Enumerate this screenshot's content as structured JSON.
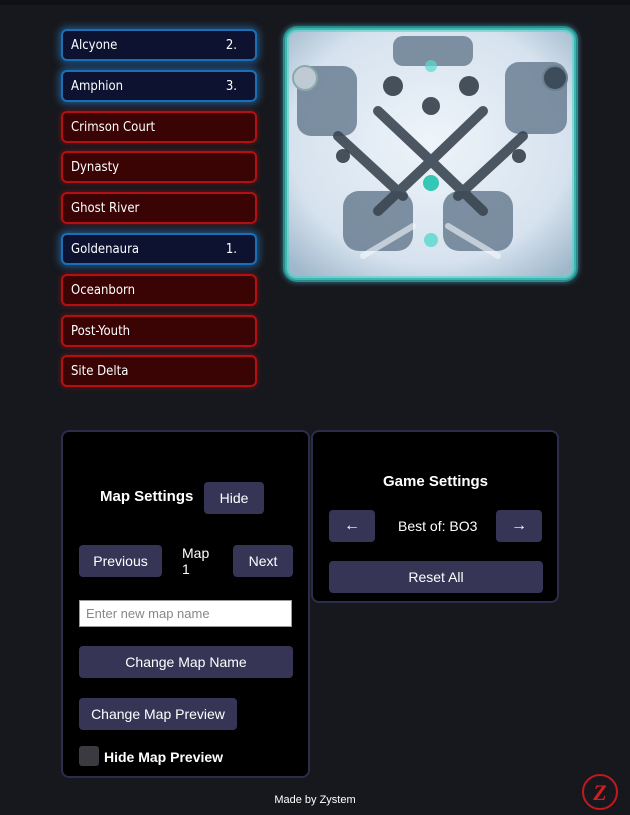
{
  "maps": [
    {
      "name": "Alcyone",
      "order": "2.",
      "selected": true
    },
    {
      "name": "Amphion",
      "order": "3.",
      "selected": true
    },
    {
      "name": "Crimson Court",
      "order": "",
      "selected": false
    },
    {
      "name": "Dynasty",
      "order": "",
      "selected": false
    },
    {
      "name": "Ghost River",
      "order": "",
      "selected": false
    },
    {
      "name": "Goldenaura",
      "order": "1.",
      "selected": true
    },
    {
      "name": "Oceanborn",
      "order": "",
      "selected": false
    },
    {
      "name": "Post-Youth",
      "order": "",
      "selected": false
    },
    {
      "name": "Site Delta",
      "order": "",
      "selected": false
    }
  ],
  "map_settings": {
    "title": "Map Settings",
    "hide_label": "Hide",
    "previous_label": "Previous",
    "map_label": "Map",
    "map_number": "1",
    "next_label": "Next",
    "name_input_placeholder": "Enter new map name",
    "name_input_value": "",
    "change_name_label": "Change Map Name",
    "change_preview_label": "Change Map Preview",
    "hide_preview_label": "Hide Map Preview",
    "hide_preview_checked": false
  },
  "game_settings": {
    "title": "Game Settings",
    "prev_arrow": "←",
    "best_of_text": "Best of: BO3",
    "next_arrow": "→",
    "reset_label": "Reset All"
  },
  "footer": {
    "text": "Made by Zystem"
  },
  "logo": {
    "letter": "Z"
  },
  "colors": {
    "background": "#17181d",
    "selected_border": "#1c6fb4",
    "unselected_border": "#b40f12",
    "button": "#373556",
    "panel_border": "#2b2d4a"
  }
}
